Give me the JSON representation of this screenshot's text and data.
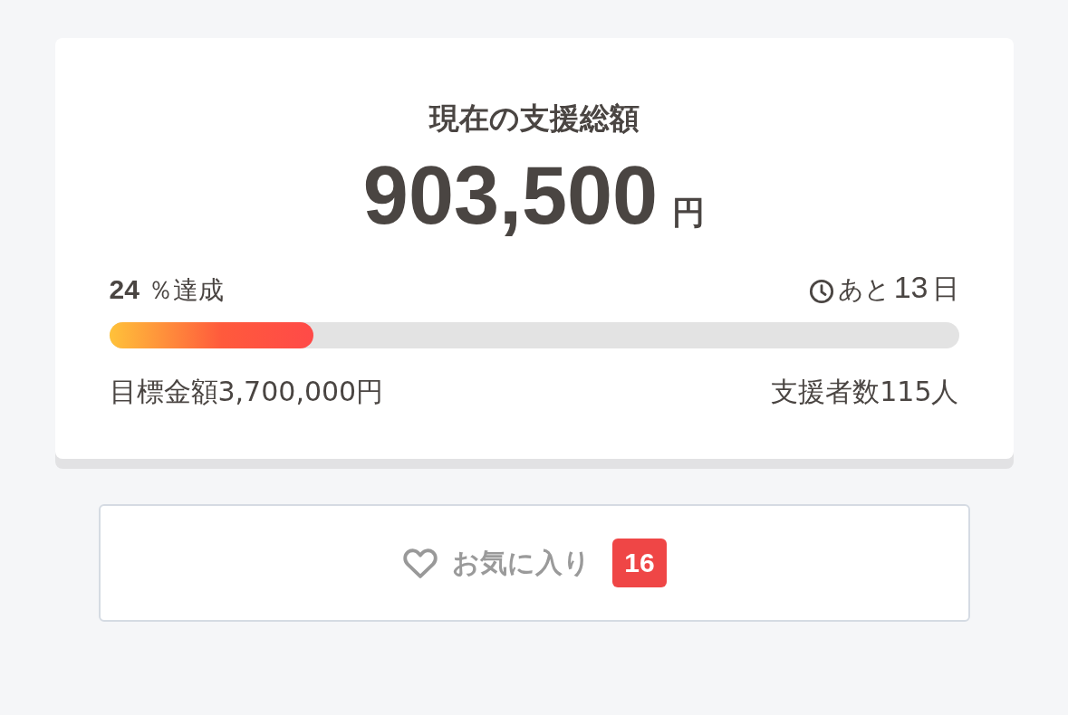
{
  "funding": {
    "title": "現在の支援総額",
    "amount": "903,500",
    "currency": "円",
    "achieved": "**24** ％達成",
    "remaining_prefix": "あと",
    "remaining_days": "13",
    "remaining_unit": "日",
    "progress": {
      "level": 0.24
    },
    "goal": "目標金額3,700,000円",
    "backers": "支援者数115人"
  },
  "favorite_button": {
    "label": "お気に入り",
    "count": "16"
  }
}
